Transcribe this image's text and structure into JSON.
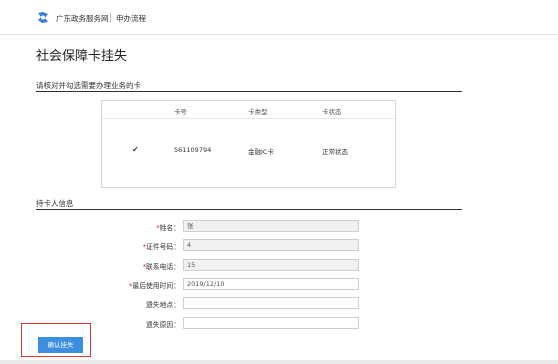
{
  "header": {
    "site_name": "广东政务服务网",
    "breadcrumb": "申办流程"
  },
  "page": {
    "title": "社会保障卡挂失"
  },
  "card_section": {
    "heading": "请核对并勾选需要办理业务的卡",
    "columns": [
      "卡号",
      "卡类型",
      "卡状态"
    ],
    "rows": [
      {
        "checked": true,
        "check_mark": "✔",
        "card_number": "561109794",
        "card_type": "金融IC卡",
        "card_status": "正常状态"
      }
    ]
  },
  "holder_section": {
    "heading": "持卡人信息",
    "fields": [
      {
        "label": "姓名：",
        "required": true,
        "value": "张"
      },
      {
        "label": "证件号码：",
        "required": true,
        "value": "4"
      },
      {
        "label": "联系电话：",
        "required": true,
        "value": "15"
      },
      {
        "label": "最后使用时间：",
        "required": true,
        "value": "2019/12/10"
      },
      {
        "label": "遗失地点：",
        "required": false,
        "value": ""
      },
      {
        "label": "遗失原因：",
        "required": false,
        "value": ""
      }
    ],
    "required_mark": "*"
  },
  "actions": {
    "confirm_label": "确认挂失"
  },
  "colors": {
    "primary_button": "#3c8ee0",
    "highlight": "#e53935",
    "required": "#e02020"
  }
}
